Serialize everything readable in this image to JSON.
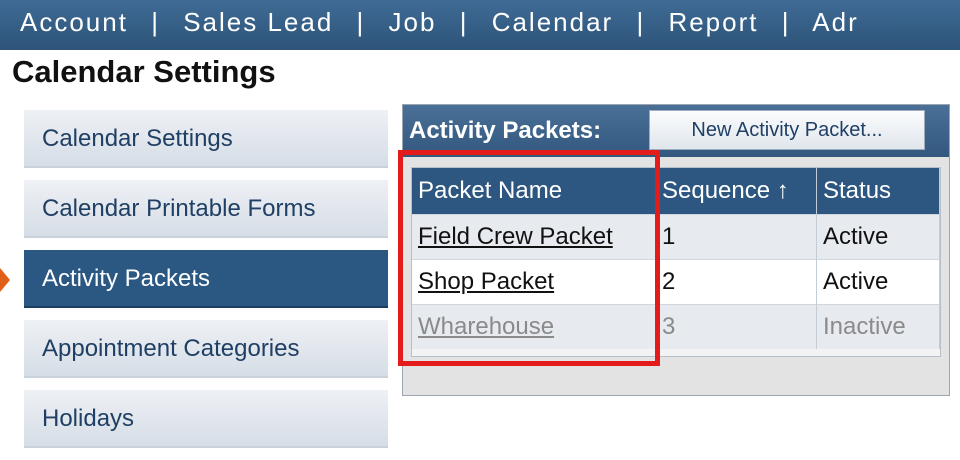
{
  "topnav": {
    "items": [
      "Account",
      "Sales Lead",
      "Job",
      "Calendar",
      "Report",
      "Adr"
    ],
    "separator": "|"
  },
  "page": {
    "title": "Calendar Settings"
  },
  "sidebar": {
    "items": [
      {
        "label": "Calendar Settings",
        "active": false
      },
      {
        "label": "Calendar Printable Forms",
        "active": false
      },
      {
        "label": "Activity Packets",
        "active": true
      },
      {
        "label": "Appointment Categories",
        "active": false
      },
      {
        "label": "Holidays",
        "active": false
      }
    ]
  },
  "panel": {
    "title": "Activity Packets:",
    "new_button_label": "New Activity Packet...",
    "columns": [
      "Packet Name",
      "Sequence ↑",
      "Status"
    ],
    "rows": [
      {
        "name": "Field Crew Packet",
        "sequence": "1",
        "status": "Active"
      },
      {
        "name": "Shop Packet",
        "sequence": "2",
        "status": "Active"
      },
      {
        "name": "Wharehouse",
        "sequence": "3",
        "status": "Inactive"
      }
    ]
  },
  "colors": {
    "nav_bar": "#2d5479",
    "active_sidebar": "#2b5783",
    "grid_header": "#2d5780",
    "highlight_box": "#e31b1b",
    "pointer_arrow": "#e0601a"
  }
}
